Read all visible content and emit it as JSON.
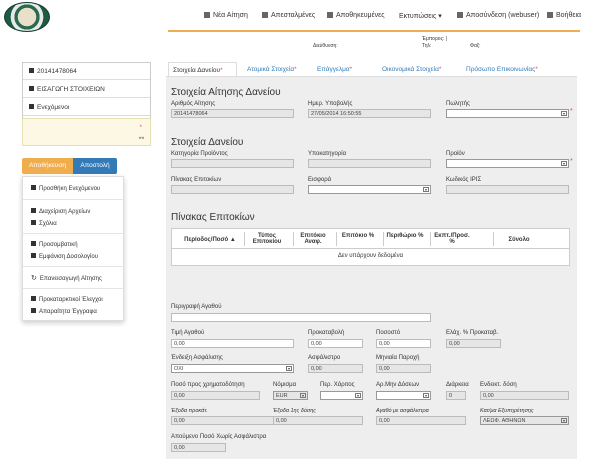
{
  "nav": {
    "new": "Νέα Αίτηση",
    "sent": "Απεσταλμένες",
    "saved": "Αποθηκευμένες",
    "print": "Εκτυπώσεις ▾",
    "logout": "Αποσύνδεση (webuser)",
    "help": "Βοήθεια"
  },
  "header_info": {
    "address": "Διεύθυνση:",
    "merchant": "Έμπορος: |",
    "tel": "Τηλ:",
    "fax": "Φαξ:"
  },
  "left": {
    "app_number": "20141478064",
    "import": "ΕΙΣΑΓΩΓΗ ΣΤΟΙΧΕΙΩΝ",
    "pledged": "Ενεχόμενοι",
    "save_btn": "Αποθήκευση",
    "send_btn": "Αποστολή",
    "menu": {
      "add_pledged": "Προσθήκη Ενεχόμενου",
      "files": "Διαχείριση Αρχείων",
      "comments": "Σχόλια",
      "promo": "Προσομβατική",
      "show_plan": "Εμφάνιση Δοσολογίου",
      "restore": "Επανεισαγωγή Αίτησης",
      "prechecks": "Προκαταρκτικοί Έλεγχοι",
      "docs": "Απαραίτητα Έγγραφα"
    }
  },
  "tabs": [
    {
      "label": "Στοιχεία Δανείου",
      "star": "*"
    },
    {
      "label": "Ατομικά Στοιχεία",
      "star": "*"
    },
    {
      "label": "Επάγγελμα",
      "star": "*"
    },
    {
      "label": "Οικονομικά Στοιχεία",
      "star": "*"
    },
    {
      "label": "Πρόσωπο Επικοινωνίας",
      "star": "*"
    }
  ],
  "section1": {
    "title": "Στοιχεία Αίτησης Δανείου",
    "app_no_label": "Αριθμός Αίτησης",
    "app_no_value": "20141478064",
    "date_label": "Ημερ. Υποβολής",
    "date_value": "27/05/2014 16:50:55",
    "seller_label": "Πωλητής"
  },
  "section2": {
    "title": "Στοιχεία Δανείου",
    "category_label": "Κατηγορία Προϊόντος",
    "subcategory_label": "Υποκατηγορία",
    "product_label": "Προϊόν",
    "rates_label": "Πίνακας Επιτοκίων",
    "payment_label": "Εισφορά",
    "code_label": "Κωδικός ΙΡΙΣ"
  },
  "section3": {
    "title": "Πίνακας Επιτοκίων",
    "columns": [
      "Περίοδος/Ποσό ▲",
      "Τύπος Επιτοκίου",
      "Επιτόκιο Αναφ.",
      "Επιτόκιο %",
      "Περιθώριο %",
      "Εκπτ./Προσ. %",
      "Σύνολο"
    ],
    "empty": "Δεν υπάρχουν δεδομένα"
  },
  "section4": {
    "desc_label": "Περιγραφή Αγαθού",
    "price_label": "Τιμή Αγαθού",
    "price_value": "0,00",
    "down_label": "Προκαταβολή",
    "down_value": "0,00",
    "pct_label": "Ποσοστό",
    "pct_value": "0,00",
    "min_pct_label": "Ελάχ. % Προκαταβ.",
    "min_pct_value": "0,00",
    "insurance_label": "Ένδειξη Ασφάλισης",
    "insurance_value": "ΟΧΙ",
    "premium_label": "Ασφάλιστρο",
    "premium_value": "0,00",
    "monthly_label": "Μηνιαία Παροχή",
    "monthly_value": "0,00",
    "financed_label": "Ποσό προς χρηματοδότηση",
    "financed_value": "0,00",
    "currency_label": "Νόμισμα",
    "currency_value": "EUR",
    "grace_label": "Περ. Χάριτος",
    "instal_label": "Αρ.Μην Δόσεων",
    "duration_label": "Διάρκεια",
    "duration_value": "0",
    "ind_label": "Ενδεικτ. δόση",
    "ind_value": "0,00",
    "fee1_label": "Έξοδα προκάτ.",
    "fee1_value": "0,00",
    "fee2_label": "Έξοδα 1ης δόσης",
    "fee2_value": "0,00",
    "goods_ins_label": "Αγαθό με ασφάλιστρα",
    "goods_ins_value": "0,00",
    "store_label": "Κατ/μα Εξυπηρέτησης",
    "store_value": "ΛΕΩΦ. ΑΘΗΝΩΝ",
    "remain_label": "Απούμενο Ποσό Χωρίς Ασφάλιστρα",
    "remain_value": "0,00"
  }
}
